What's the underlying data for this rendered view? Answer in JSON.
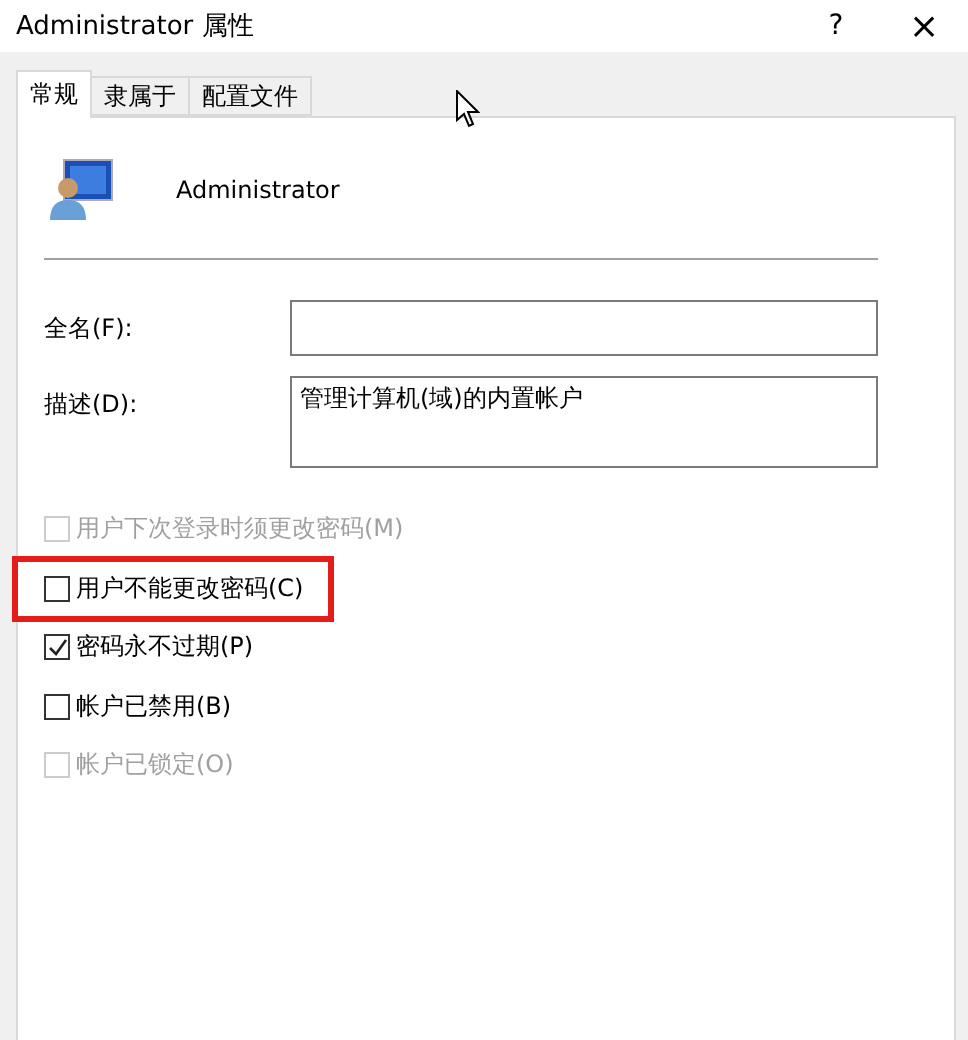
{
  "window": {
    "title": "Administrator 属性",
    "help_button": "?",
    "close_button": "×"
  },
  "tabs": [
    {
      "label": "常规",
      "selected": true
    },
    {
      "label": "隶属于",
      "selected": false
    },
    {
      "label": "配置文件",
      "selected": false
    }
  ],
  "user": {
    "name": "Administrator"
  },
  "fields": [
    {
      "label": "全名(F):",
      "kind": "line"
    },
    {
      "label": "描述(D):",
      "value": "管理计算机(域)的内置帐户",
      "kind": "area"
    }
  ],
  "options": [
    {
      "label": "用户下次登录时须更改密码(M)",
      "checked": false,
      "disabled": true,
      "highlighted": false
    },
    {
      "label": "用户不能更改密码(C)",
      "checked": false,
      "disabled": false,
      "highlighted": true
    },
    {
      "label": "密码永不过期(P)",
      "checked": true,
      "disabled": false,
      "highlighted": false
    },
    {
      "label": "帐户已禁用(B)",
      "checked": false,
      "disabled": false,
      "highlighted": false
    },
    {
      "label": "帐户已锁定(O)",
      "checked": false,
      "disabled": true,
      "highlighted": false
    }
  ]
}
